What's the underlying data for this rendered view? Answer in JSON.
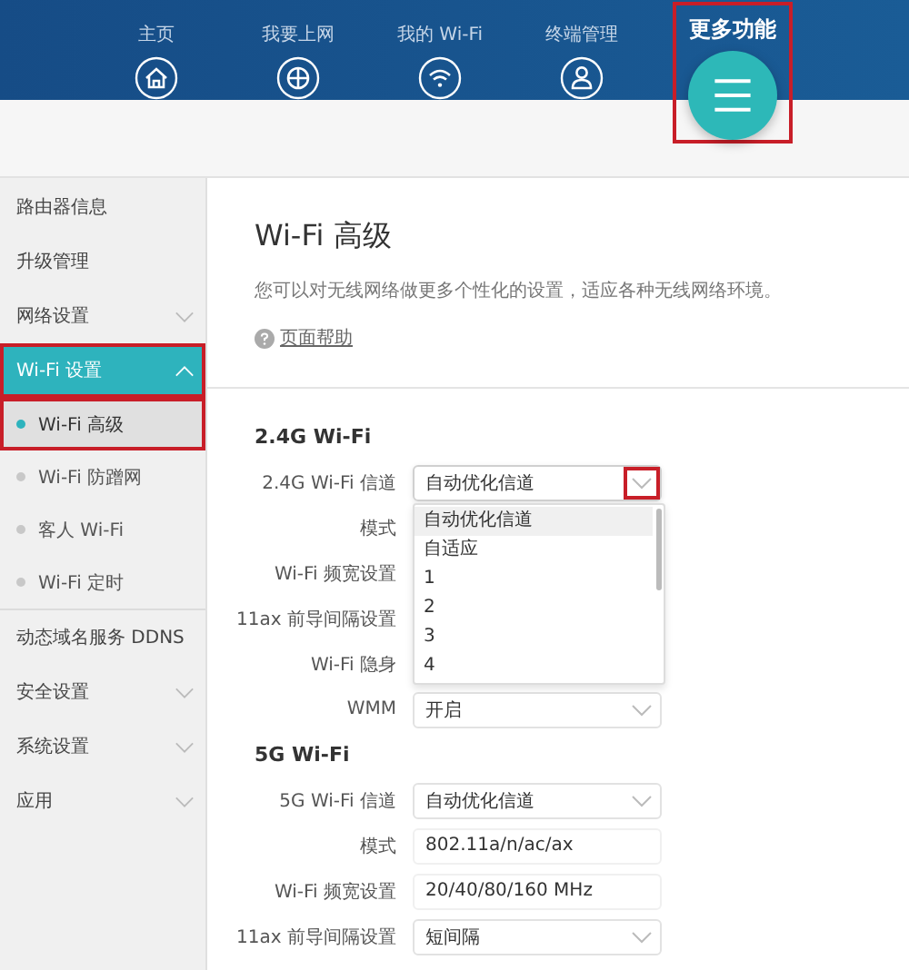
{
  "nav": [
    {
      "label": "主页",
      "selected": false,
      "highlighted": false
    },
    {
      "label": "我要上网",
      "selected": false,
      "highlighted": false
    },
    {
      "label": "我的 Wi-Fi",
      "selected": false,
      "highlighted": false
    },
    {
      "label": "终端管理",
      "selected": false,
      "highlighted": false
    },
    {
      "label": "更多功能",
      "selected": true,
      "highlighted": true
    }
  ],
  "sidebar": {
    "items": [
      {
        "label": "路由器信息",
        "kind": "link",
        "selected": false,
        "highlighted": false
      },
      {
        "label": "升级管理",
        "kind": "link",
        "selected": false,
        "highlighted": false
      },
      {
        "label": "网络设置",
        "kind": "group",
        "expanded": false,
        "selected": false,
        "highlighted": false
      },
      {
        "label": "Wi-Fi 设置",
        "kind": "group",
        "expanded": true,
        "selected": true,
        "highlighted": true,
        "children": [
          {
            "label": "Wi-Fi 高级",
            "selected": true,
            "highlighted": true
          },
          {
            "label": "Wi-Fi 防蹭网",
            "selected": false,
            "highlighted": false
          },
          {
            "label": "客人 Wi-Fi",
            "selected": false,
            "highlighted": false
          },
          {
            "label": "Wi-Fi 定时",
            "selected": false,
            "highlighted": false
          }
        ]
      },
      {
        "label": "动态域名服务 DDNS",
        "kind": "link",
        "selected": false,
        "highlighted": false
      },
      {
        "label": "安全设置",
        "kind": "group",
        "expanded": false,
        "selected": false,
        "highlighted": false
      },
      {
        "label": "系统设置",
        "kind": "group",
        "expanded": false,
        "selected": false,
        "highlighted": false
      },
      {
        "label": "应用",
        "kind": "group",
        "expanded": false,
        "selected": false,
        "highlighted": false
      }
    ]
  },
  "page": {
    "title": "Wi-Fi 高级",
    "description": "您可以对无线网络做更多个性化的设置，适应各种无线网络环境。",
    "help_link": "页面帮助"
  },
  "sections": [
    {
      "heading": "2.4G Wi-Fi",
      "fields": [
        {
          "label": "2.4G Wi-Fi 信道",
          "kind": "select",
          "value": "自动优化信道",
          "open": true,
          "caret_highlighted": true,
          "options": [
            {
              "label": "自动优化信道",
              "selected": true
            },
            {
              "label": "自适应",
              "selected": false
            },
            {
              "label": "1",
              "selected": false
            },
            {
              "label": "2",
              "selected": false
            },
            {
              "label": "3",
              "selected": false
            },
            {
              "label": "4",
              "selected": false
            }
          ]
        },
        {
          "label": "模式",
          "kind": "covered"
        },
        {
          "label": "Wi-Fi 频宽设置",
          "kind": "covered"
        },
        {
          "label": "11ax 前导间隔设置",
          "kind": "covered"
        },
        {
          "label": "Wi-Fi 隐身",
          "kind": "covered"
        },
        {
          "label": "WMM",
          "kind": "select",
          "value": "开启"
        }
      ]
    },
    {
      "heading": "5G Wi-Fi",
      "fields": [
        {
          "label": "5G Wi-Fi 信道",
          "kind": "select",
          "value": "自动优化信道"
        },
        {
          "label": "模式",
          "kind": "text",
          "value": "802.11a/n/ac/ax"
        },
        {
          "label": "Wi-Fi 频宽设置",
          "kind": "text",
          "value": "20/40/80/160 MHz"
        },
        {
          "label": "11ax 前导间隔设置",
          "kind": "select",
          "value": "短间隔"
        }
      ]
    }
  ]
}
